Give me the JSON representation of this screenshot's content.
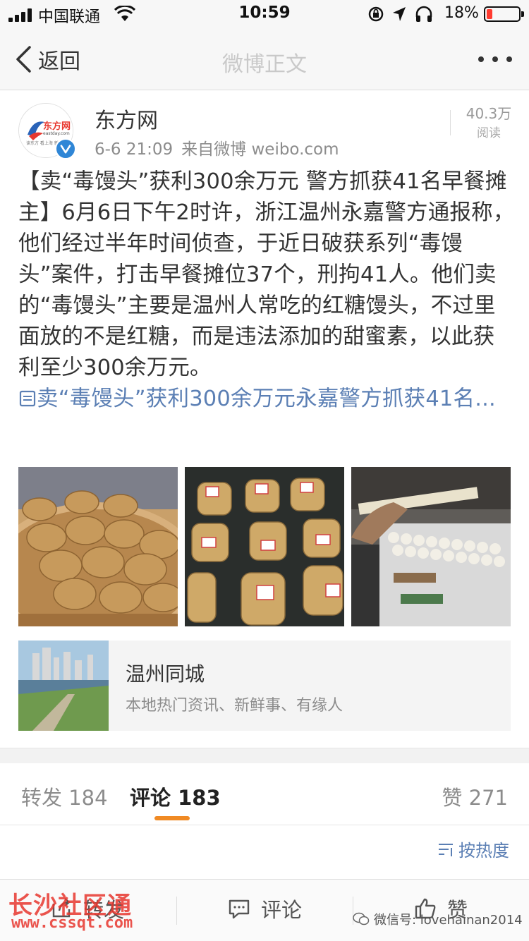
{
  "status_bar": {
    "carrier": "中国联通",
    "time": "10:59",
    "battery": "18%"
  },
  "nav": {
    "back_label": "返回",
    "title": "微博正文"
  },
  "post": {
    "author": "东方网",
    "date": "6-6 21:09",
    "source": "来自微博 weibo.com",
    "read_count": "40.3万",
    "read_label": "阅读",
    "text": "【卖“毒馒头”获利300余万元 警方抓获41名早餐摊主】6月6日下午2时许，浙江温州永嘉警方通报称，他们经过半年时间侦查，于近日破获系列“毒馒头”案件，打击早餐摊位37个，刑拘41人。他们卖的“毒馒头”主要是温州人常吃的红糖馒头，不过里面放的不是红糖，而是违法添加的甜蜜素，以此获利至少300余万元。",
    "link_text": "卖“毒馒头”获利300余万元永嘉警方抓获41名..."
  },
  "card": {
    "title": "温州同城",
    "desc": "本地热门资讯、新鲜事、有缘人"
  },
  "tabs": {
    "repost": "转发 184",
    "comment": "评论 183",
    "like": "赞 271"
  },
  "sort_label": "按热度",
  "toolbar": {
    "repost": "转发",
    "comment": "评论",
    "like": "赞"
  },
  "watermarks": {
    "left_title": "长沙社区通",
    "left_url": "www.cssqt.com",
    "right": "微信号: lovehainan2014"
  }
}
